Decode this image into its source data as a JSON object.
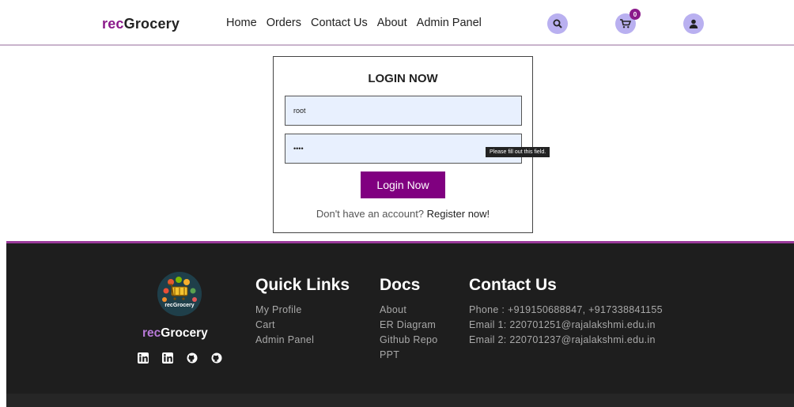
{
  "header": {
    "logo_prefix": "rec",
    "logo_suffix": "Grocery",
    "nav": [
      "Home",
      "Orders",
      "Contact Us",
      "About",
      "Admin Panel"
    ],
    "cart_count": "0"
  },
  "login": {
    "title": "LOGIN NOW",
    "username_value": "root",
    "password_value": "••••",
    "tooltip": "Please fill out this field.",
    "button": "Login Now",
    "register_text": "Don't have an account?",
    "register_link": "Register now!"
  },
  "footer": {
    "brand_prefix": "rec",
    "brand_suffix": "Grocery",
    "logo_text": "recGrocery",
    "quick_links_title": "Quick Links",
    "quick_links": [
      "My Profile",
      "Cart",
      "Admin Panel"
    ],
    "docs_title": "Docs",
    "docs": [
      "About",
      "ER Diagram",
      "Github Repo",
      "PPT"
    ],
    "contact_title": "Contact Us",
    "contact": [
      "Phone : +919150688847, +917338841155",
      "Email 1: 220701251@rajalakshmi.edu.in",
      "Email 2: 220701237@rajalakshmi.edu.in"
    ],
    "social": [
      "linkedin-icon",
      "linkedin-icon",
      "github-icon",
      "github-icon"
    ]
  },
  "colors": {
    "accent": "#800080",
    "icon_bg": "#b9b0f0",
    "footer_bg": "#1e1e1e"
  }
}
